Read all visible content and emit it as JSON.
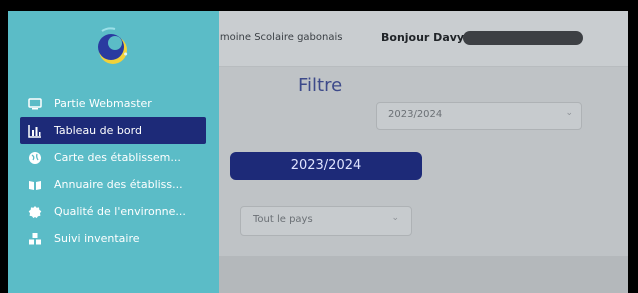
{
  "topbar": {
    "breadcrumb": "rimoine Scolaire gabonais",
    "greeting": "Bonjour Davy"
  },
  "filter": {
    "title": "Filtre",
    "year_select_value": "2023/2024",
    "year_badge": "2023/2024",
    "region_select_value": "Tout le pays"
  },
  "sidebar": {
    "items": [
      {
        "label": "Partie Webmaster",
        "icon": "monitor-icon"
      },
      {
        "label": "Tableau de bord",
        "icon": "bar-chart-icon",
        "active": true
      },
      {
        "label": "Carte des établissem...",
        "icon": "globe-icon"
      },
      {
        "label": "Annuaire des établiss...",
        "icon": "book-icon"
      },
      {
        "label": "Qualité de l'environne...",
        "icon": "badge-icon"
      },
      {
        "label": "Suivi inventaire",
        "icon": "boxes-icon"
      }
    ]
  },
  "colors": {
    "sidebar": "#5bbcc7",
    "active": "#1d2a78",
    "title": "#3d4a8a"
  }
}
